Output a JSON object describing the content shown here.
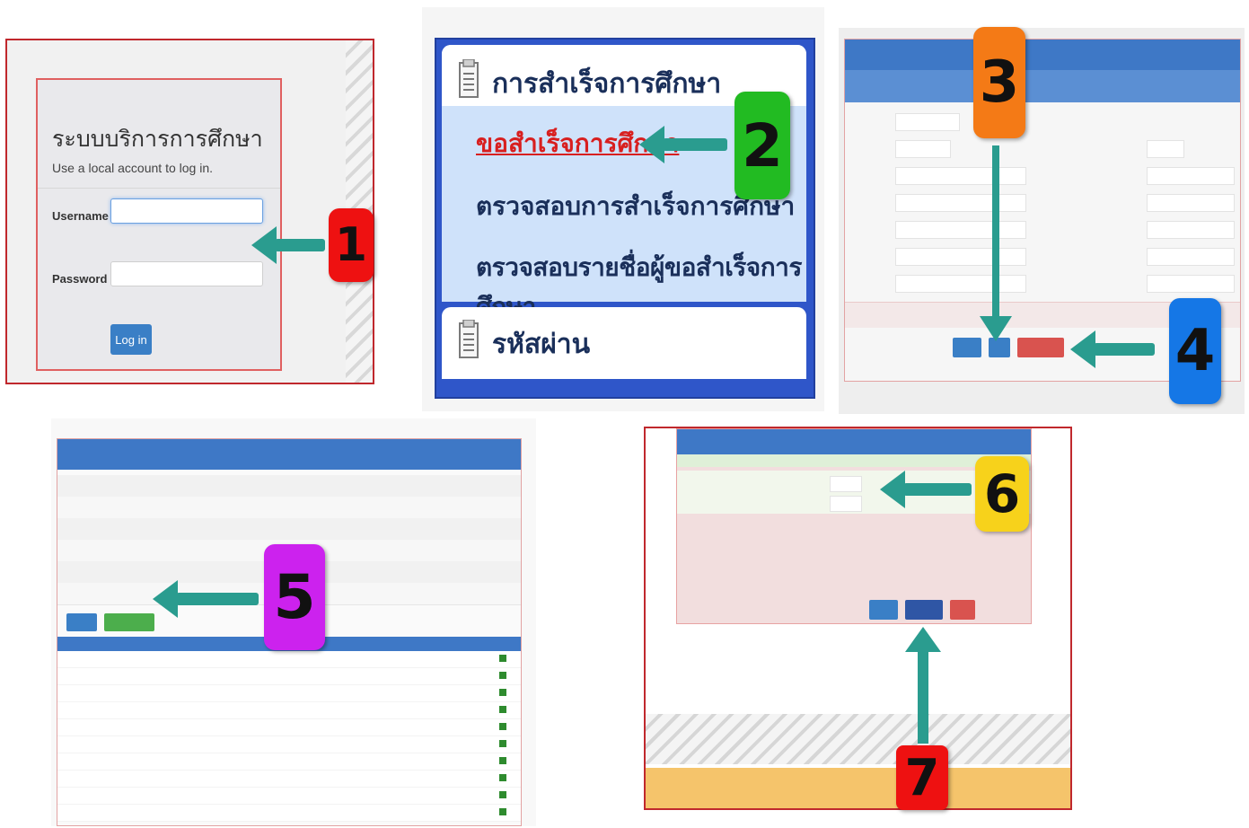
{
  "colors": {
    "accent_teal": "#2a9c8f",
    "login_blue": "#3a7fc6",
    "badge_red": "#ee1111",
    "badge_green": "#22bb22",
    "badge_orange": "#f47a16",
    "badge_blue": "#1577e6",
    "badge_purple": "#cc22ee",
    "badge_yellow": "#f7d21b",
    "header_blue": "#3e78c6",
    "danger_red": "#d9534f"
  },
  "login": {
    "title": "ระบบบริการการศึกษา",
    "subtitle": "Use a local account to log in.",
    "username_label": "Username",
    "password_label": "Password",
    "username_value": "",
    "password_value": "",
    "login_button": "Log in"
  },
  "menu": {
    "section1_title": "การสำเร็จการศึกษา",
    "item_request": "ขอสำเร็จการศึกษา",
    "item_check": "ตรวจสอบการสำเร็จการศึกษา",
    "item_check_list": "ตรวจสอบรายชื่อผู้ขอสำเร็จการศึกษา",
    "section2_title": "รหัสผ่าน",
    "icon": "document-icon"
  },
  "steps": [
    "1",
    "2",
    "3",
    "4",
    "5",
    "6",
    "7"
  ]
}
